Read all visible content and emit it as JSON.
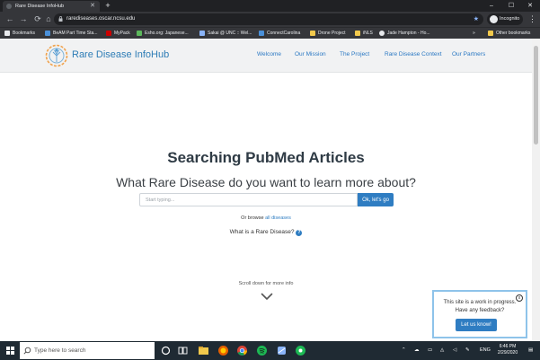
{
  "browser": {
    "tab_title": "Rare Disease InfoHub",
    "tab_close": "✕",
    "new_tab": "+",
    "minimize": "–",
    "maximize": "☐",
    "close": "✕",
    "url": "rarediseases.oscar.ncsu.edu",
    "incognito_label": "Incognito",
    "menu": "⋮",
    "bookmarks": [
      "Bookmarks",
      "BeAM Part Time Sta...",
      "MyPack",
      "Esho.org: Japanese...",
      "Sakai @ UNC :: Wel...",
      "ConnectCarolina",
      "Drone Project",
      "iNLS",
      "Jade Hampton - Ho..."
    ],
    "bookmarks_more": "»",
    "other_bookmarks": "Other bookmarks"
  },
  "nav": {
    "brand": "Rare Disease InfoHub",
    "links": [
      "Welcome",
      "Our Mission",
      "The Project",
      "Rare Disease Context",
      "Our Partners"
    ]
  },
  "hero": {
    "title": "Searching PubMed Articles",
    "subtitle": "What Rare Disease do you want to learn more about?",
    "search_placeholder": "Start typing...",
    "search_button": "Ok, let's go",
    "browse_prefix": "Or browse",
    "browse_link": "all diseases",
    "what_is": "What is a Rare Disease?",
    "help_icon": "?",
    "scroll_hint": "Scroll down for more info"
  },
  "feedback": {
    "line1": "This site is a work in progress.",
    "line2": "Have any feedback?",
    "button": "Let us know!",
    "close": "x"
  },
  "taskbar": {
    "search_placeholder": "Type here to search",
    "language": "ENG",
    "time": "6:46 PM",
    "date": "2/29/2020"
  },
  "colors": {
    "accent": "#2f7dc2",
    "brand": "#2e7db6",
    "feedback_border": "#8ec3ea"
  }
}
